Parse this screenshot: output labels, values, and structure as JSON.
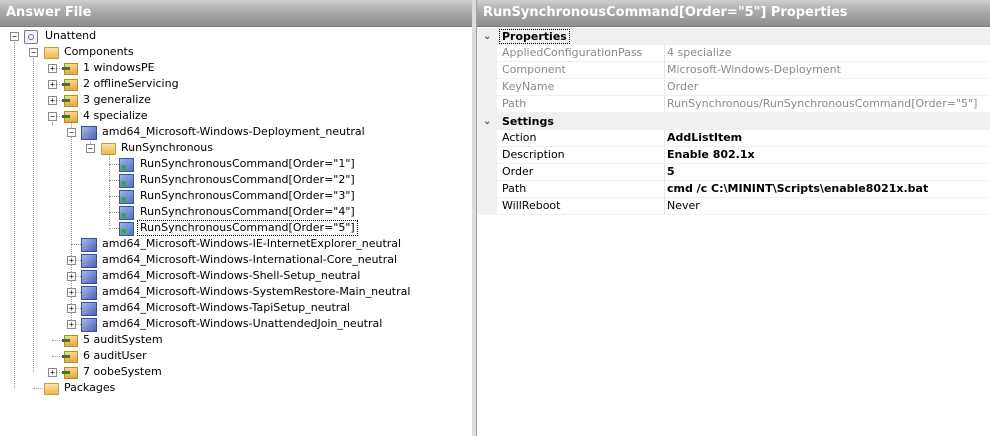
{
  "left_pane": {
    "title": "Answer File"
  },
  "tree": {
    "root": "Unattend",
    "components": "Components",
    "passes": [
      "1 windowsPE",
      "2 offlineServicing",
      "3 generalize",
      "4 specialize"
    ],
    "deployment_component": "amd64_Microsoft-Windows-Deployment_neutral",
    "runsync": "RunSynchronous",
    "commands": [
      "RunSynchronousCommand[Order=\"1\"]",
      "RunSynchronousCommand[Order=\"2\"]",
      "RunSynchronousCommand[Order=\"3\"]",
      "RunSynchronousCommand[Order=\"4\"]",
      "RunSynchronousCommand[Order=\"5\"]"
    ],
    "other_components": [
      "amd64_Microsoft-Windows-IE-InternetExplorer_neutral",
      "amd64_Microsoft-Windows-International-Core_neutral",
      "amd64_Microsoft-Windows-Shell-Setup_neutral",
      "amd64_Microsoft-Windows-SystemRestore-Main_neutral",
      "amd64_Microsoft-Windows-TapiSetup_neutral",
      "amd64_Microsoft-Windows-UnattendedJoin_neutral"
    ],
    "later_passes": [
      "5 auditSystem",
      "6 auditUser",
      "7 oobeSystem"
    ],
    "packages": "Packages"
  },
  "right_pane": {
    "title": "RunSynchronousCommand[Order=\"5\"] Properties"
  },
  "properties": {
    "category_properties": "Properties",
    "readonly_rows": [
      {
        "key": "AppliedConfigurationPass",
        "value": "4 specialize"
      },
      {
        "key": "Component",
        "value": "Microsoft-Windows-Deployment"
      },
      {
        "key": "KeyName",
        "value": "Order"
      },
      {
        "key": "Path",
        "value": "RunSynchronous/RunSynchronousCommand[Order=\"5\"]"
      }
    ],
    "category_settings": "Settings",
    "settings_rows": [
      {
        "key": "Action",
        "value": "AddListItem"
      },
      {
        "key": "Description",
        "value": "Enable 802.1x"
      },
      {
        "key": "Order",
        "value": "5"
      },
      {
        "key": "Path",
        "value": "cmd /c C:\\MININT\\Scripts\\enable8021x.bat"
      },
      {
        "key": "WillReboot",
        "value": "Never"
      }
    ]
  },
  "icons": {
    "expand": "plus-box",
    "collapse": "minus-box",
    "category_expanded": "chevron-down"
  }
}
